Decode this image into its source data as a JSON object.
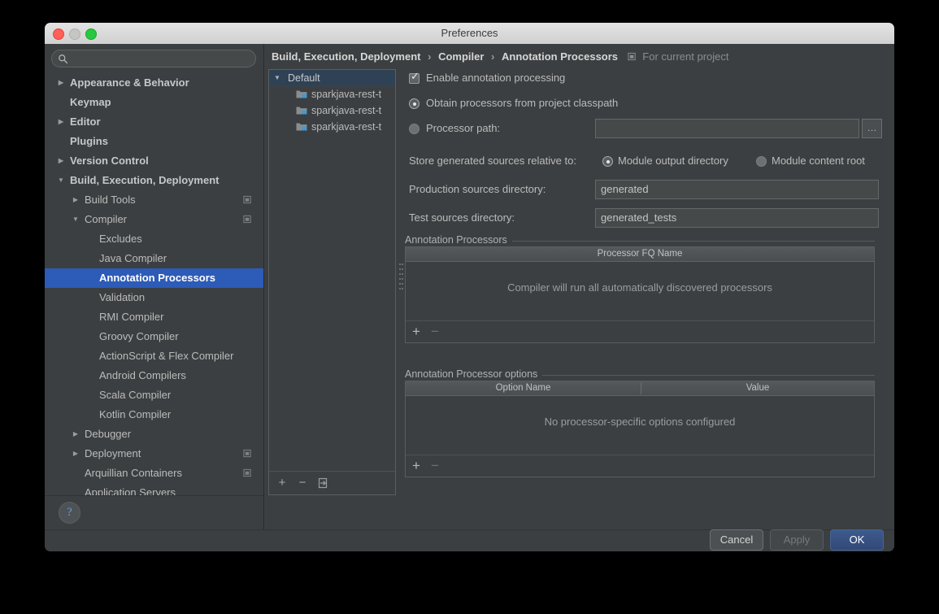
{
  "window": {
    "title": "Preferences",
    "traffic_lights": [
      "close-button",
      "minimize-button",
      "maximize-button"
    ]
  },
  "sidebar": {
    "search": {
      "value": "",
      "placeholder": "",
      "icon": "search-icon"
    },
    "items": [
      {
        "label": "Appearance & Behavior",
        "level": 0,
        "arrow": "▶",
        "bold": true,
        "selected": false,
        "project_icon": false
      },
      {
        "label": "Keymap",
        "level": 0,
        "arrow": "",
        "bold": true,
        "selected": false,
        "project_icon": false
      },
      {
        "label": "Editor",
        "level": 0,
        "arrow": "▶",
        "bold": true,
        "selected": false,
        "project_icon": false
      },
      {
        "label": "Plugins",
        "level": 0,
        "arrow": "",
        "bold": true,
        "selected": false,
        "project_icon": false
      },
      {
        "label": "Version Control",
        "level": 0,
        "arrow": "▶",
        "bold": true,
        "selected": false,
        "project_icon": false
      },
      {
        "label": "Build, Execution, Deployment",
        "level": 0,
        "arrow": "▼",
        "bold": true,
        "selected": false,
        "project_icon": false
      },
      {
        "label": "Build Tools",
        "level": 1,
        "arrow": "▶",
        "bold": false,
        "selected": false,
        "project_icon": true
      },
      {
        "label": "Compiler",
        "level": 1,
        "arrow": "▼",
        "bold": false,
        "selected": false,
        "project_icon": true
      },
      {
        "label": "Excludes",
        "level": 2,
        "arrow": "",
        "bold": false,
        "selected": false,
        "project_icon": false
      },
      {
        "label": "Java Compiler",
        "level": 2,
        "arrow": "",
        "bold": false,
        "selected": false,
        "project_icon": false
      },
      {
        "label": "Annotation Processors",
        "level": 2,
        "arrow": "",
        "bold": false,
        "selected": true,
        "project_icon": false
      },
      {
        "label": "Validation",
        "level": 2,
        "arrow": "",
        "bold": false,
        "selected": false,
        "project_icon": false
      },
      {
        "label": "RMI Compiler",
        "level": 2,
        "arrow": "",
        "bold": false,
        "selected": false,
        "project_icon": false
      },
      {
        "label": "Groovy Compiler",
        "level": 2,
        "arrow": "",
        "bold": false,
        "selected": false,
        "project_icon": false
      },
      {
        "label": "ActionScript & Flex Compiler",
        "level": 2,
        "arrow": "",
        "bold": false,
        "selected": false,
        "project_icon": false
      },
      {
        "label": "Android Compilers",
        "level": 2,
        "arrow": "",
        "bold": false,
        "selected": false,
        "project_icon": false
      },
      {
        "label": "Scala Compiler",
        "level": 2,
        "arrow": "",
        "bold": false,
        "selected": false,
        "project_icon": false
      },
      {
        "label": "Kotlin Compiler",
        "level": 2,
        "arrow": "",
        "bold": false,
        "selected": false,
        "project_icon": false
      },
      {
        "label": "Debugger",
        "level": 1,
        "arrow": "▶",
        "bold": false,
        "selected": false,
        "project_icon": false
      },
      {
        "label": "Deployment",
        "level": 1,
        "arrow": "▶",
        "bold": false,
        "selected": false,
        "project_icon": true
      },
      {
        "label": "Arquillian Containers",
        "level": 1,
        "arrow": "",
        "bold": false,
        "selected": false,
        "project_icon": true
      },
      {
        "label": "Application Servers",
        "level": 1,
        "arrow": "",
        "bold": false,
        "selected": false,
        "project_icon": false
      }
    ],
    "help_button": "?"
  },
  "breadcrumb": {
    "crumbs": [
      "Build, Execution, Deployment",
      "Compiler",
      "Annotation Processors"
    ],
    "separator": "›",
    "scope_label": "For current project",
    "scope_icon": "project-scope-icon"
  },
  "module_panel": {
    "profiles": [
      {
        "label": "Default",
        "type": "profile",
        "expanded": true,
        "arrow": "▼",
        "selected": true
      },
      {
        "label": "sparkjava-rest-t",
        "type": "module",
        "selected": false
      },
      {
        "label": "sparkjava-rest-t",
        "type": "module",
        "selected": false
      },
      {
        "label": "sparkjava-rest-t",
        "type": "module",
        "selected": false
      }
    ],
    "toolbar": {
      "add": "+",
      "remove": "−",
      "move_to": "move-to-profile-icon"
    }
  },
  "settings": {
    "enable_annotation_processing": {
      "label": "Enable annotation processing",
      "checked": true
    },
    "processor_source": {
      "selected": "obtain_from_classpath",
      "options": [
        {
          "key": "obtain_from_classpath",
          "label": "Obtain processors from project classpath",
          "selected": true
        },
        {
          "key": "processor_path",
          "label": "Processor path:",
          "selected": false
        }
      ],
      "processor_path_value": "",
      "browse_label": "…"
    },
    "store_generated": {
      "label": "Store generated sources relative to:",
      "options": [
        {
          "key": "module_output",
          "label": "Module output directory",
          "selected": true
        },
        {
          "key": "content_root",
          "label": "Module content root",
          "selected": false
        }
      ]
    },
    "production_sources": {
      "label": "Production sources directory:",
      "value": "generated"
    },
    "test_sources": {
      "label": "Test sources directory:",
      "value": "generated_tests"
    },
    "processors_group": {
      "title": "Annotation Processors",
      "columns": [
        "Processor FQ Name"
      ],
      "rows": [],
      "empty_message": "Compiler will run all automatically discovered processors",
      "toolbar": {
        "add": "+",
        "remove": "−"
      }
    },
    "options_group": {
      "title": "Annotation Processor options",
      "columns": [
        "Option Name",
        "Value"
      ],
      "rows": [],
      "empty_message": "No processor-specific options configured",
      "toolbar": {
        "add": "+",
        "remove": "−"
      }
    }
  },
  "footer": {
    "cancel": "Cancel",
    "apply": "Apply",
    "ok": "OK",
    "apply_enabled": false
  },
  "colors": {
    "window_bg": "#3c3f41",
    "selection_blue": "#2d5bb8",
    "inactive_selection": "#2f4255",
    "default_button": "#3c5a8c",
    "text_primary": "#bbbbbb",
    "text_bright": "#d6d6d6",
    "text_dim": "#8a8d8f",
    "link_blue": "#5f9ee0",
    "module_icon_badge": "#3e9ad6"
  }
}
